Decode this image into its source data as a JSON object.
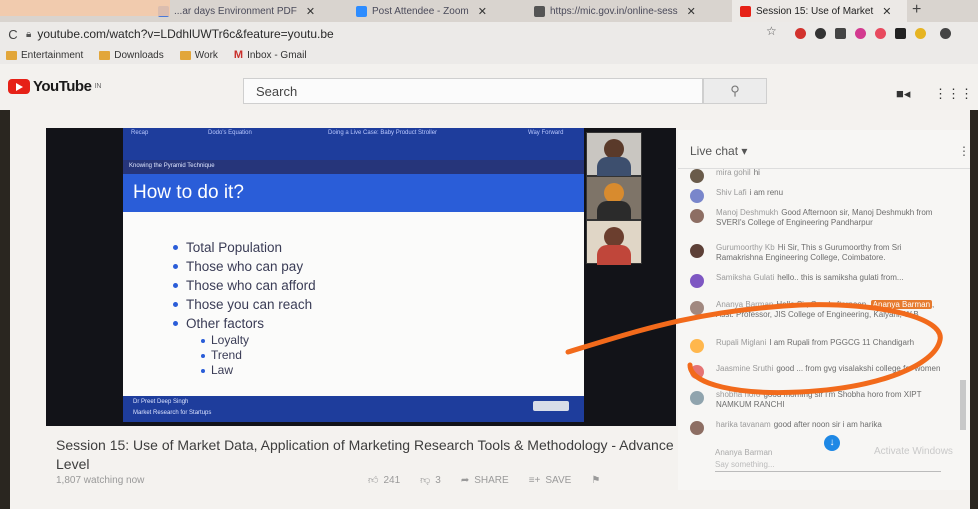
{
  "browser": {
    "tabs": [
      {
        "label": "...ar days Environment PDF",
        "color": "#4a78d8",
        "active": false
      },
      {
        "label": "Post Attendee - Zoom",
        "color": "#2d8cff",
        "active": false
      },
      {
        "label": "https://mic.gov.in/online-sess",
        "color": "#555555",
        "active": false
      },
      {
        "label": "Session 15: Use of Market",
        "color": "#e62117",
        "active": true
      }
    ],
    "new_tab": "+",
    "url": "youtube.com/watch?v=LDdhlUWTr6c&feature=youtu.be",
    "bookmarks": [
      {
        "label": "Entertainment",
        "icon": "folder-icon"
      },
      {
        "label": "Downloads",
        "icon": "folder-icon"
      },
      {
        "label": "Work",
        "icon": "folder-icon"
      },
      {
        "label": "Inbox - Gmail",
        "icon": "gmail-icon"
      }
    ]
  },
  "youtube": {
    "logo_text": "YouTube",
    "region": "IN",
    "search_placeholder": "Search",
    "icons": [
      "search-icon",
      "video-camera-icon",
      "apps-grid-icon"
    ]
  },
  "slide": {
    "nav": [
      "Recap",
      "Dodo's Equation",
      "Doing a Live Case: Baby Product Stroller",
      "Way Forward"
    ],
    "section": "Knowing the Pyramid Technique",
    "title": "How to do it?",
    "bullets": [
      "Total Population",
      "Those who can pay",
      "Those who can afford",
      "Those you can reach",
      "Other factors"
    ],
    "sub_bullets": [
      "Loyalty",
      "Trend",
      "Law"
    ],
    "footer_author": "Dr Preet Deep Singh",
    "footer_course": "Market Research for Startups"
  },
  "video": {
    "title": "Session 15: Use of Market Data, Application of Marketing Research Tools & Methodology - Advance Level",
    "watching": "1,807 watching now",
    "likes": "241",
    "dislikes": "3",
    "share": "SHARE",
    "save": "SAVE"
  },
  "chat": {
    "header": "Live chat",
    "messages": [
      {
        "author": "mira gohil",
        "text": "hi",
        "color": "#6a5b4a"
      },
      {
        "author": "Shiv Lafi",
        "text": "i am renu",
        "color": "#7986cb"
      },
      {
        "author": "Manoj Deshmukh",
        "text": "Good Afternoon sir, Manoj Deshmukh from SVERI's College of Engineering Pandharpur",
        "color": "#8d6e63"
      },
      {
        "author": "Gurumoorthy Kb",
        "text": "Hi Sir, This s Gurumoorthy from Sri Ramakrishna Engineering College, Coimbatore.",
        "color": "#5d4037"
      },
      {
        "author": "Samiksha Gulati",
        "text": "hello.. this is samiksha gulati from...",
        "color": "#7e57c2"
      },
      {
        "author": "Ananya Barman",
        "text": "Hello Sir, Good afternoon, Ananya Barman, Asst. Professor, JIS College of Engineering, Kalyani, W.B",
        "highlight": "Ananya Barman",
        "color": "#a1887f"
      },
      {
        "author": "Rupali Miglani",
        "text": "I am Rupali from PGGCG 11 Chandigarh",
        "color": "#ffb74d"
      },
      {
        "author": "Jaasmine Sruthi",
        "text": "good ... from gvg visalakshi college for women",
        "color": "#e57373"
      },
      {
        "author": "shobha horo",
        "text": "good morning sir i'm Shobha horo from XIPT NAMKUM RANCHI",
        "color": "#90a4ae"
      },
      {
        "author": "harika tavanam",
        "text": "good after noon sir i am harika",
        "color": "#8d6e63"
      }
    ],
    "input_name": "Ananya Barman",
    "input_placeholder": "Say something...",
    "watermark": "Activate Windows"
  }
}
